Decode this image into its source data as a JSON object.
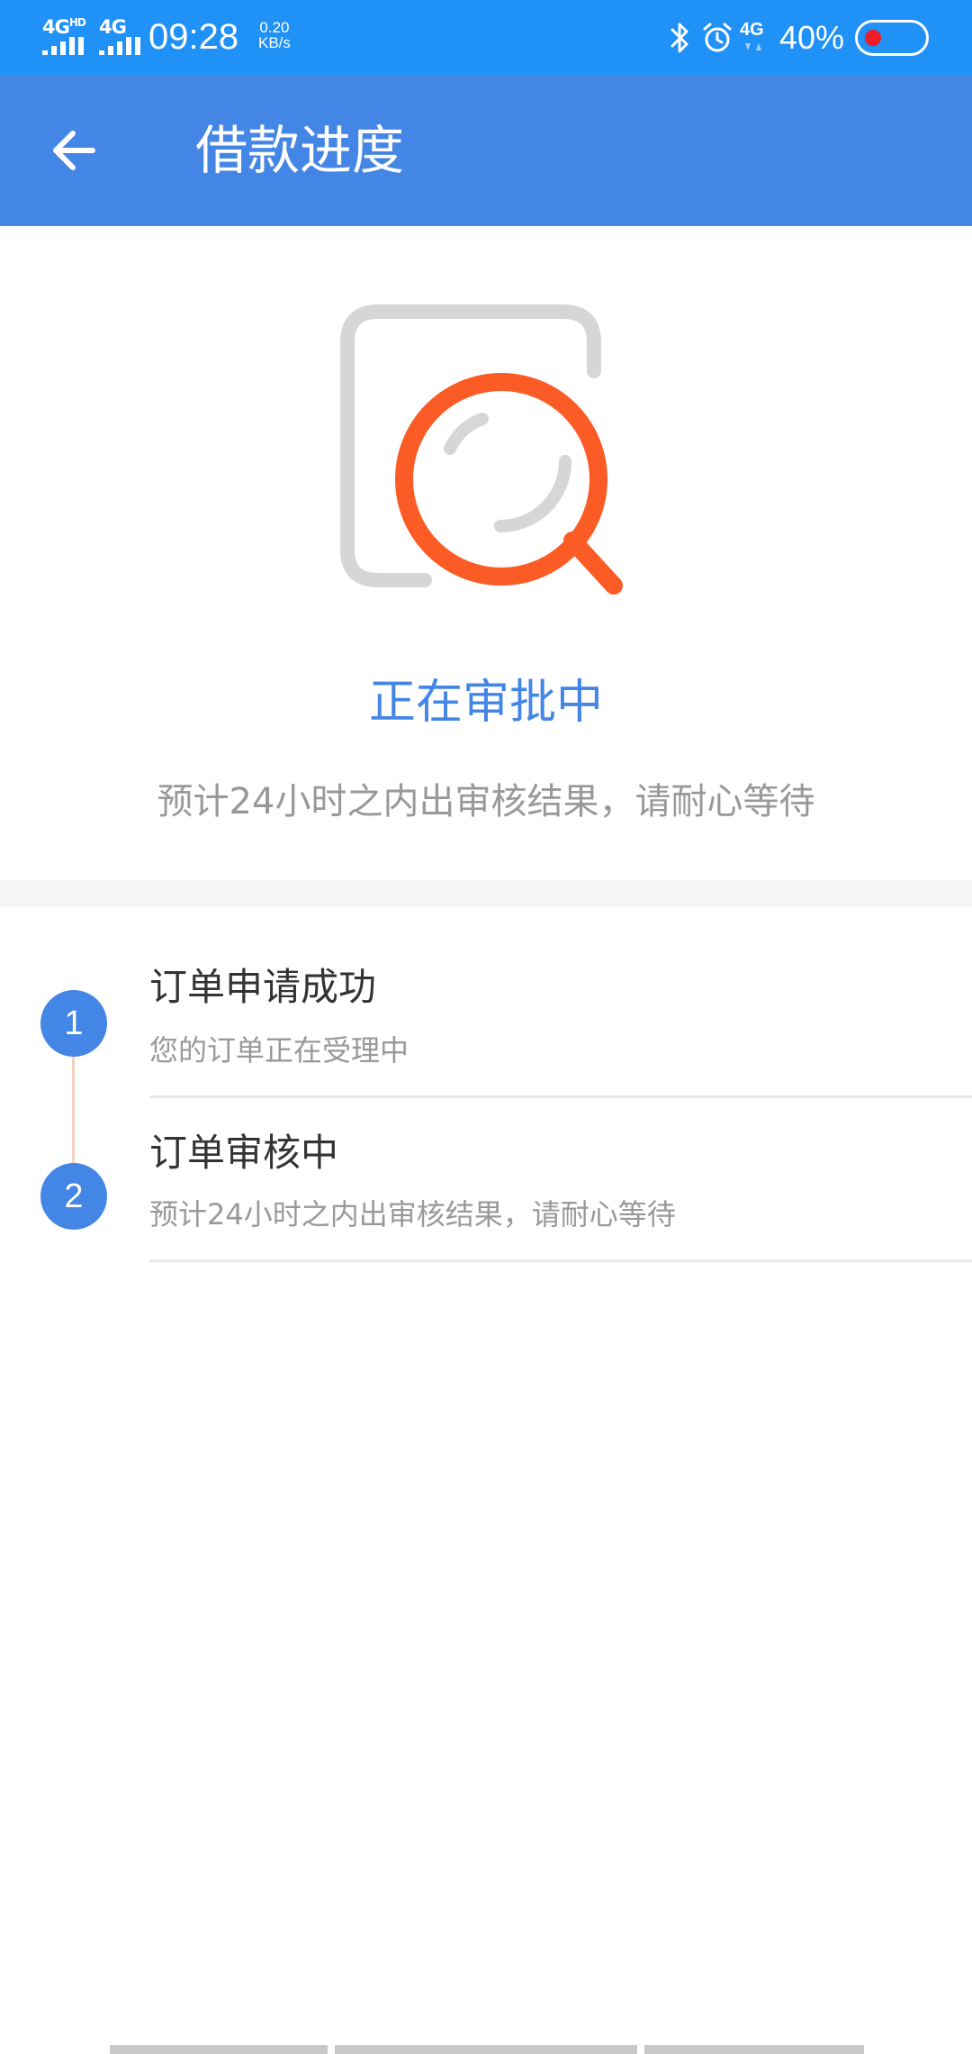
{
  "status_bar": {
    "network_1": "4G",
    "network_1_sup": "HD",
    "network_2": "4G",
    "time": "09:28",
    "speed_value": "0.20",
    "speed_unit": "KB/s",
    "data_network": "4G",
    "battery_percent": "40%",
    "icons": [
      "signal-icon",
      "bluetooth-icon",
      "alarm-icon",
      "battery-icon"
    ]
  },
  "app_bar": {
    "title": "借款进度",
    "back_icon": "arrow-left-icon"
  },
  "status": {
    "illustration_icon": "search-document-icon",
    "title": "正在审批中",
    "subtitle": "预计24小时之内出审核结果，请耐心等待"
  },
  "steps": [
    {
      "number": "1",
      "title": "订单申请成功",
      "desc": "您的订单正在受理中"
    },
    {
      "number": "2",
      "title": "订单审核中",
      "desc": "预计24小时之内出审核结果，请耐心等待"
    }
  ],
  "colors": {
    "status_bar": "#1f91f7",
    "app_bar": "#4486e6",
    "accent": "#4486e6",
    "magnifier": "#fb5c26",
    "document": "#d6d6d6",
    "timeline_line": "#f1d2bd",
    "battery_dot": "#ee1c25"
  }
}
